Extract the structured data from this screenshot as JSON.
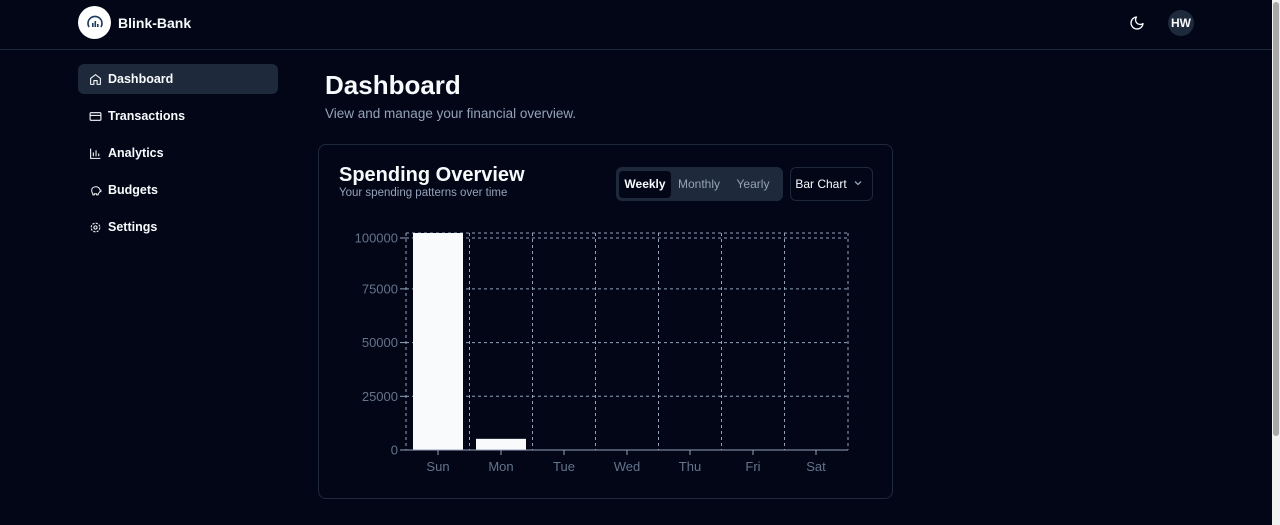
{
  "app": {
    "brand": "Blink-Bank",
    "avatar_initials": "HW"
  },
  "icons": {
    "logo": "signal-chart-logo",
    "theme": "moon-icon",
    "chevron": "chevron-down-icon"
  },
  "colors": {
    "background": "#020617",
    "border": "#1e293b",
    "muted": "#94a3b8",
    "bar": "#f8fafc"
  },
  "sidebar": {
    "items": [
      {
        "label": "Dashboard",
        "icon": "home-icon",
        "active": true
      },
      {
        "label": "Transactions",
        "icon": "credit-card-icon",
        "active": false
      },
      {
        "label": "Analytics",
        "icon": "bar-chart-icon",
        "active": false
      },
      {
        "label": "Budgets",
        "icon": "piggy-bank-icon",
        "active": false
      },
      {
        "label": "Settings",
        "icon": "gear-icon",
        "active": false
      }
    ]
  },
  "page": {
    "title": "Dashboard",
    "subtitle": "View and manage your financial overview."
  },
  "card": {
    "title": "Spending Overview",
    "subtitle": "Your spending patterns over time",
    "tabs": [
      {
        "label": "Weekly",
        "active": true
      },
      {
        "label": "Monthly",
        "active": false
      },
      {
        "label": "Yearly",
        "active": false
      }
    ],
    "chart_type_select": "Bar Chart"
  },
  "chart_data": {
    "type": "bar",
    "categories": [
      "Sun",
      "Mon",
      "Tue",
      "Wed",
      "Thu",
      "Fri",
      "Sat"
    ],
    "values": [
      101000,
      5200,
      0,
      0,
      0,
      0,
      0
    ],
    "yticks": [
      "0",
      "25000",
      "50000",
      "75000",
      "100000"
    ],
    "ylim": [
      0,
      101000
    ],
    "grid": true
  }
}
